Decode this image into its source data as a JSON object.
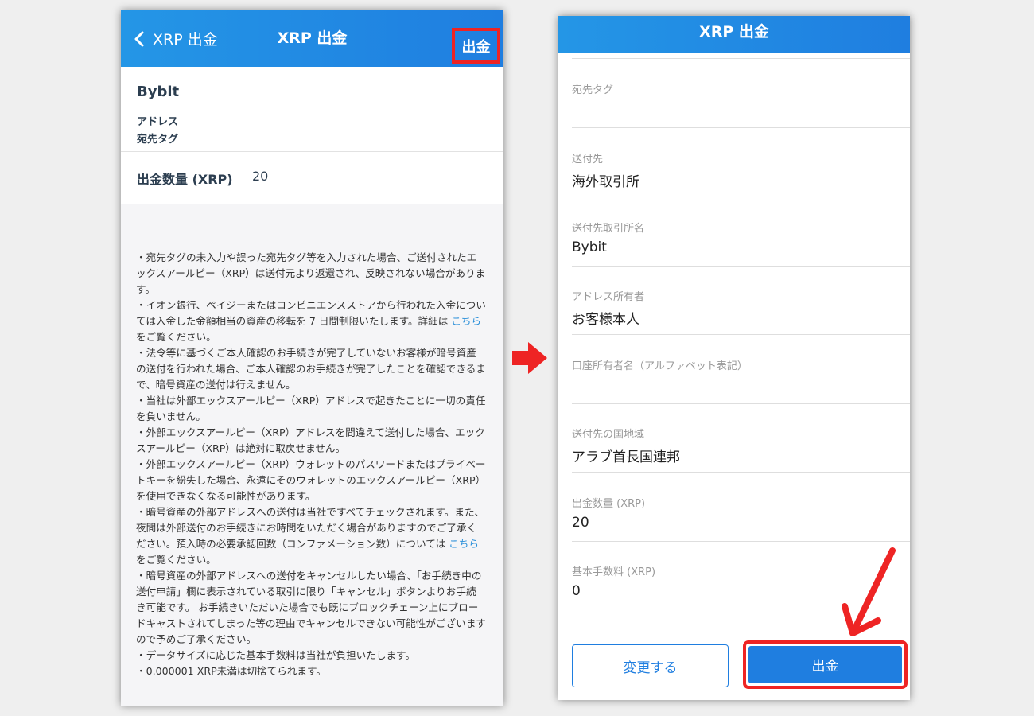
{
  "left_screen": {
    "nav": {
      "back_label": "XRP 出金",
      "title": "XRP 出金",
      "action_label": "出金"
    },
    "destination": {
      "name": "Bybit",
      "address_label": "アドレス",
      "tag_label": "宛先タグ"
    },
    "amount": {
      "label": "出金数量 (XRP)",
      "value": "20"
    },
    "notes": [
      {
        "text": "・宛先タグの未入力や誤った宛先タグ等を入力された場合、ご送付されたエックスアールピー（XRP）は送付元より返還され、反映されない場合があります。"
      },
      {
        "pre": "・イオン銀行、ペイジーまたはコンビニエンスストアから行われた入金については入金した金額相当の資産の移転を 7 日間制限いたします。詳細は ",
        "link": "こちら",
        "post": "をご覧ください。"
      },
      {
        "text": "・法令等に基づくご本人確認のお手続きが完了していないお客様が暗号資産の送付を行われた場合、ご本人確認のお手続きが完了したことを確認できるまで、暗号資産の送付は行えません。"
      },
      {
        "text": "・当社は外部エックスアールピー（XRP）アドレスで起きたことに一切の責任を負いません。"
      },
      {
        "text": "・外部エックスアールピー（XRP）アドレスを間違えて送付した場合、エックスアールピー（XRP）は絶対に取戻せません。"
      },
      {
        "text": "・外部エックスアールピー（XRP）ウォレットのパスワードまたはプライベートキーを紛失した場合、永遠にそのウォレットのエックスアールピー（XRP）を使用できなくなる可能性があります。"
      },
      {
        "pre": "・暗号資産の外部アドレスへの送付は当社ですべてチェックされます。また、夜間は外部送付のお手続きにお時間をいただく場合がありますのでご了承ください。預入時の必要承認回数（コンファメーション数）については ",
        "link": "こちら",
        "post": "をご覧ください。"
      },
      {
        "text": "・暗号資産の外部アドレスへの送付をキャンセルしたい場合、「お手続き中の送付申請」欄に表示されている取引に限り「キャンセル」ボタンよりお手続き可能です。 お手続きいただいた場合でも既にブロックチェーン上にブロードキャストされてしまった等の理由でキャンセルできない可能性がございますので予めご了承ください。"
      },
      {
        "text": "・データサイズに応じた基本手数料は当社が負担いたします。"
      },
      {
        "text": "・0.000001 XRP未満は切捨てられます。"
      }
    ]
  },
  "right_screen": {
    "nav": {
      "title": "XRP 出金"
    },
    "fields": [
      {
        "label": "宛先タグ",
        "value": ""
      },
      {
        "label": "送付先",
        "value": "海外取引所"
      },
      {
        "label": "送付先取引所名",
        "value": "Bybit"
      },
      {
        "label": "アドレス所有者",
        "value": "お客様本人"
      },
      {
        "label": "口座所有者名（アルファベット表記）",
        "value": ""
      },
      {
        "label": "送付先の国地域",
        "value": "アラブ首長国連邦"
      },
      {
        "label": "出金数量 (XRP)",
        "value": "20"
      },
      {
        "label": "基本手数料 (XRP)",
        "value": "0"
      }
    ],
    "buttons": {
      "change": "変更する",
      "submit": "出金"
    }
  },
  "colors": {
    "brand_blue": "#1f7ee0",
    "highlight_red": "#ee2424",
    "link": "#2a8fd9"
  }
}
